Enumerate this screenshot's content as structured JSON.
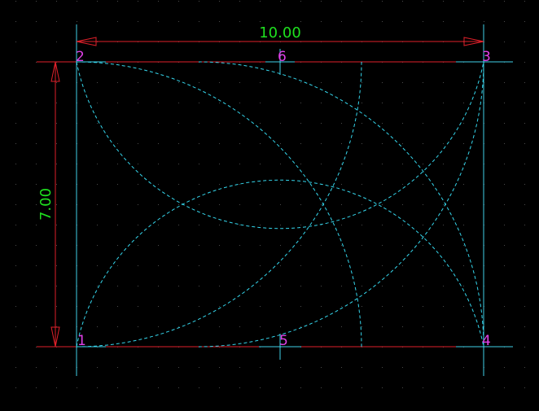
{
  "colors": {
    "background": "#000000",
    "grid": "#4a4a4a",
    "boundary": "#e0202a",
    "guide": "#3fd0e8",
    "construction": "#35d6ec",
    "dimension": "#e0202a",
    "dimension_text": "#1fe01f",
    "point_label": "#e040e8"
  },
  "dimensions": {
    "width_label": "10.00",
    "height_label": "7.00"
  },
  "points": [
    {
      "label": "1"
    },
    {
      "label": "2"
    },
    {
      "label": "3"
    },
    {
      "label": "4"
    },
    {
      "label": "5"
    },
    {
      "label": "6"
    }
  ]
}
